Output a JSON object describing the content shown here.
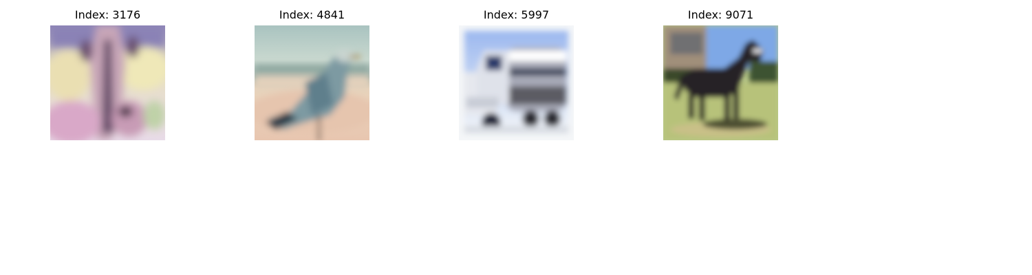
{
  "figure": {
    "panels": [
      {
        "title": "Index: 3176",
        "subject": "deer"
      },
      {
        "title": "Index: 4841",
        "subject": "bird"
      },
      {
        "title": "Index: 5997",
        "subject": "truck"
      },
      {
        "title": "Index: 9071",
        "subject": "horse"
      }
    ]
  }
}
